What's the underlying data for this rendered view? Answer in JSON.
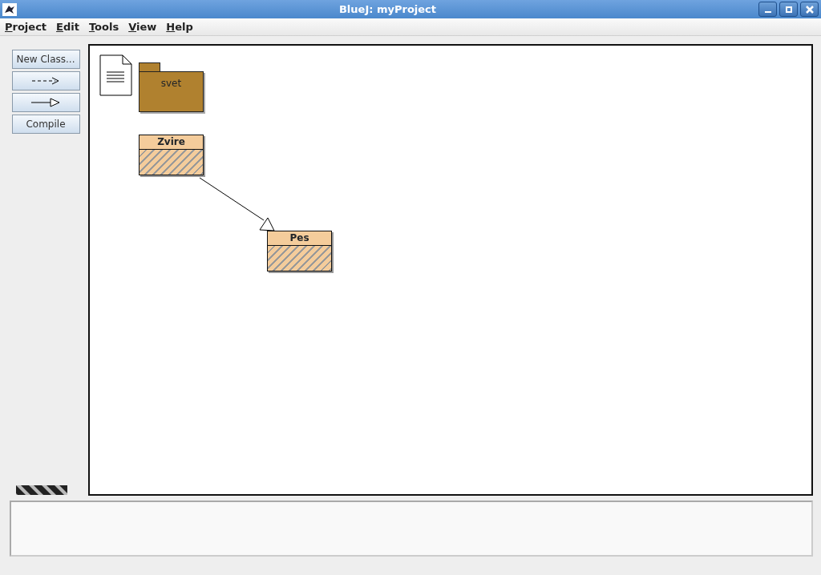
{
  "window": {
    "title": "BlueJ:  myProject"
  },
  "menus": [
    {
      "label": "Project"
    },
    {
      "label": "Edit"
    },
    {
      "label": "Tools"
    },
    {
      "label": "View"
    },
    {
      "label": "Help"
    }
  ],
  "buttons": [
    {
      "kind": "text",
      "label": "New Class..."
    },
    {
      "kind": "dependency"
    },
    {
      "kind": "inheritance"
    },
    {
      "kind": "text",
      "label": "Compile"
    }
  ],
  "diagram": {
    "packages": [
      {
        "name": "svet"
      }
    ],
    "classes": [
      {
        "name": "Zvire",
        "compiled": false
      },
      {
        "name": "Pes",
        "compiled": false
      }
    ]
  }
}
